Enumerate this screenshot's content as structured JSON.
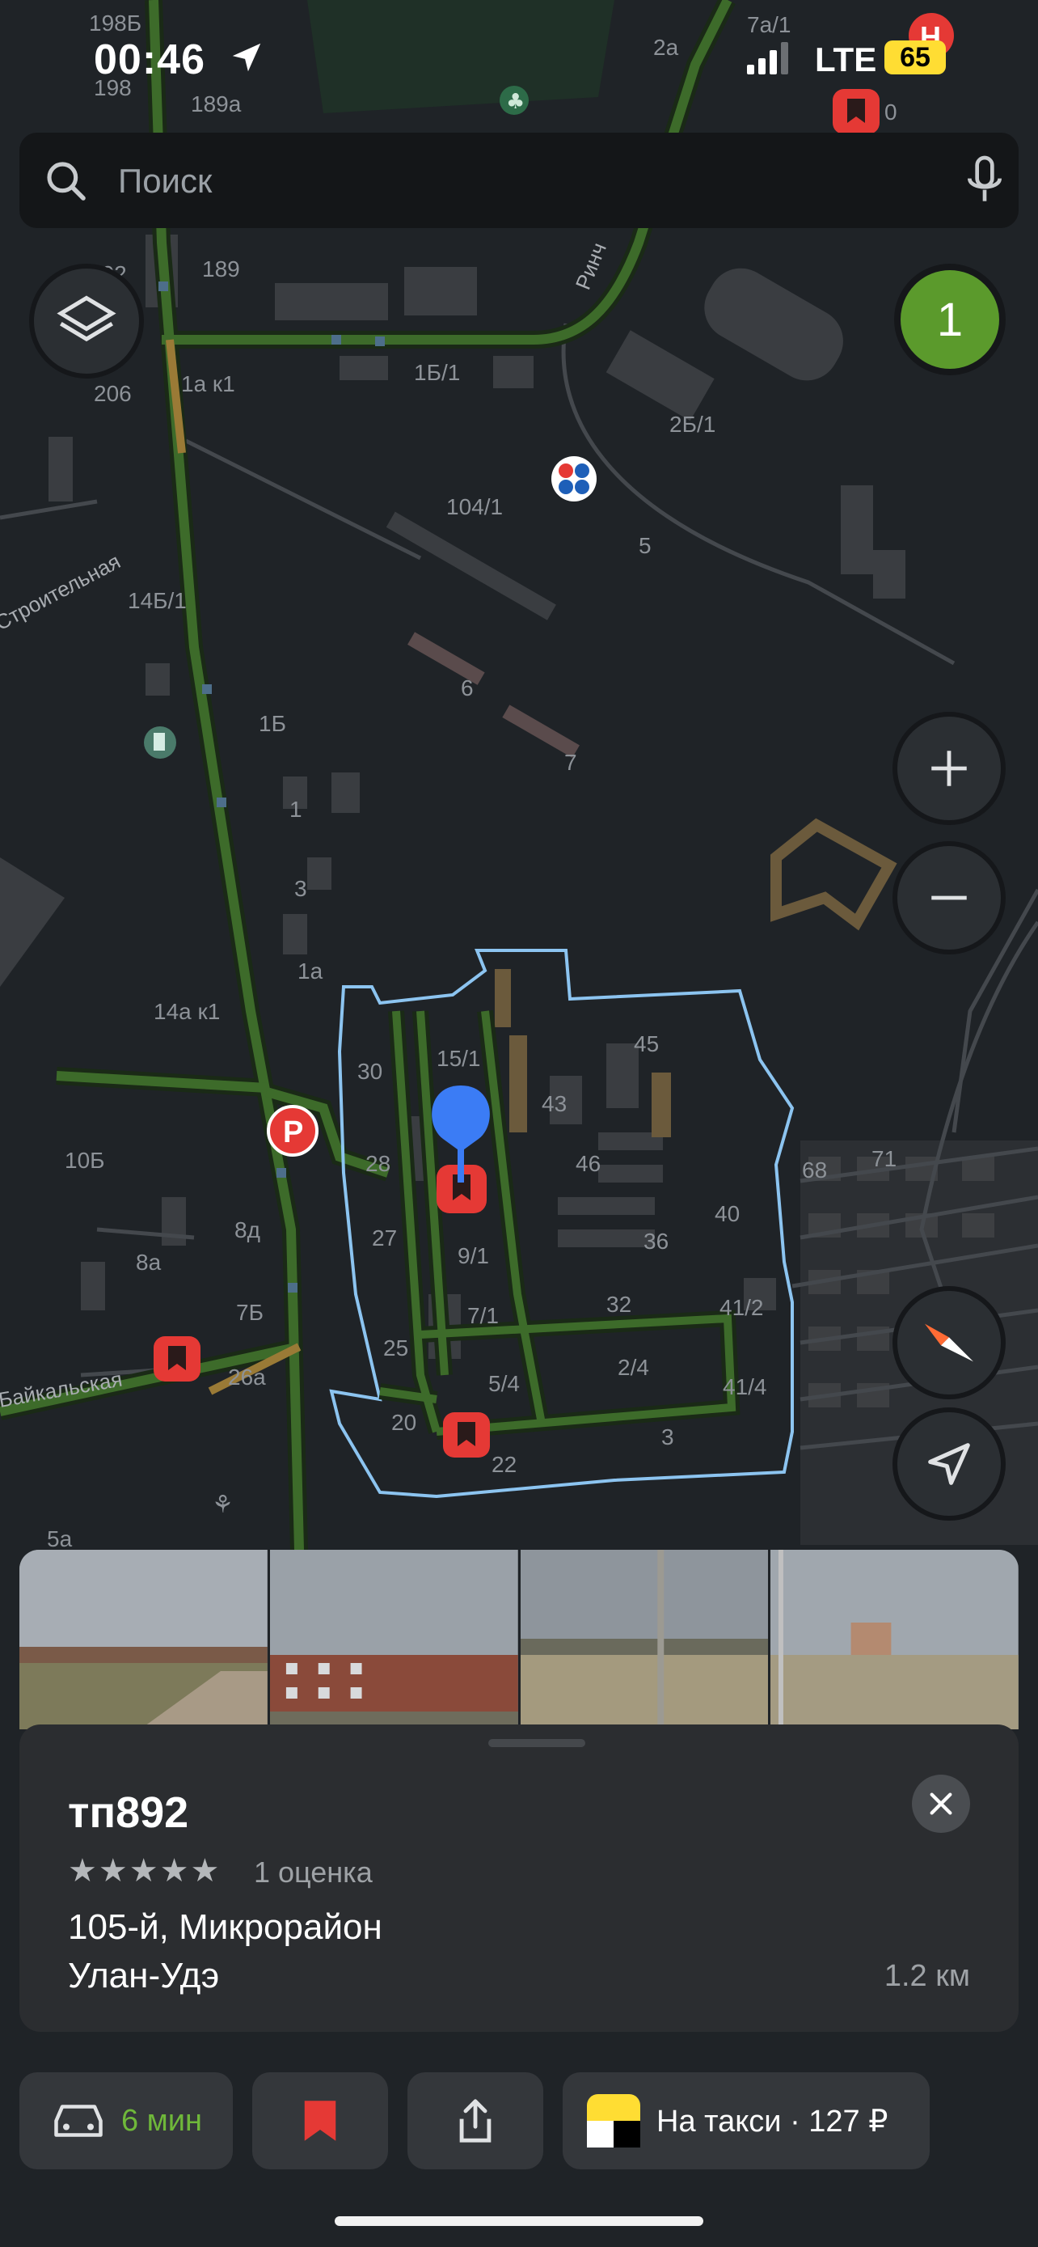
{
  "status_bar": {
    "time": "00:46",
    "network": "LTE",
    "battery": "65"
  },
  "search": {
    "placeholder": "Поиск"
  },
  "map": {
    "traffic_badge": "1",
    "labels": [
      "198Б",
      "198",
      "189а",
      "2а",
      "7а/1",
      "0",
      "202",
      "189",
      "206",
      "1а к1",
      "1Б/1",
      "2Б/1",
      "104/1",
      "5",
      "14Б/1",
      "6",
      "1Б",
      "7",
      "1",
      "3",
      "1а",
      "14а к1",
      "10Б",
      "30",
      "15/1",
      "45",
      "43",
      "28",
      "46",
      "40",
      "27",
      "9/1",
      "36",
      "8д",
      "8а",
      "68",
      "71",
      "7Б",
      "32",
      "41/2",
      "7/1",
      "25",
      "2/4",
      "5/4",
      "41/4",
      "26а",
      "20",
      "22",
      "3",
      "5а"
    ],
    "streets": [
      "Строительная",
      "Байкальская",
      "Ринч"
    ]
  },
  "place_card": {
    "title": "тп892",
    "stars": "★★★★★",
    "rating_text": "1 оценка",
    "address_line1": "105-й, Микрорайон",
    "address_line2": "Улан-Удэ",
    "distance": "1.2 км"
  },
  "bottom_bar": {
    "route_time": "6 мин",
    "taxi_label": "На такси · 127 ₽"
  },
  "colors": {
    "map_bg": "#1f2327",
    "road_green": "#3d6b2a",
    "area_outline": "#8cc4f0",
    "pin_blue": "#3b7cf5",
    "bookmark_red": "#e53935",
    "accent_green": "#6fb83a"
  },
  "icons": [
    "location-arrow-icon",
    "search-icon",
    "mic-icon",
    "layers-icon",
    "plus-icon",
    "minus-icon",
    "compass-icon",
    "navigate-arrow-icon",
    "close-icon",
    "car-icon",
    "bookmark-icon",
    "share-icon",
    "yandex-taxi-icon",
    "parking-icon",
    "fuel-icon",
    "bookmark-pin-icon",
    "map-pin-icon"
  ]
}
